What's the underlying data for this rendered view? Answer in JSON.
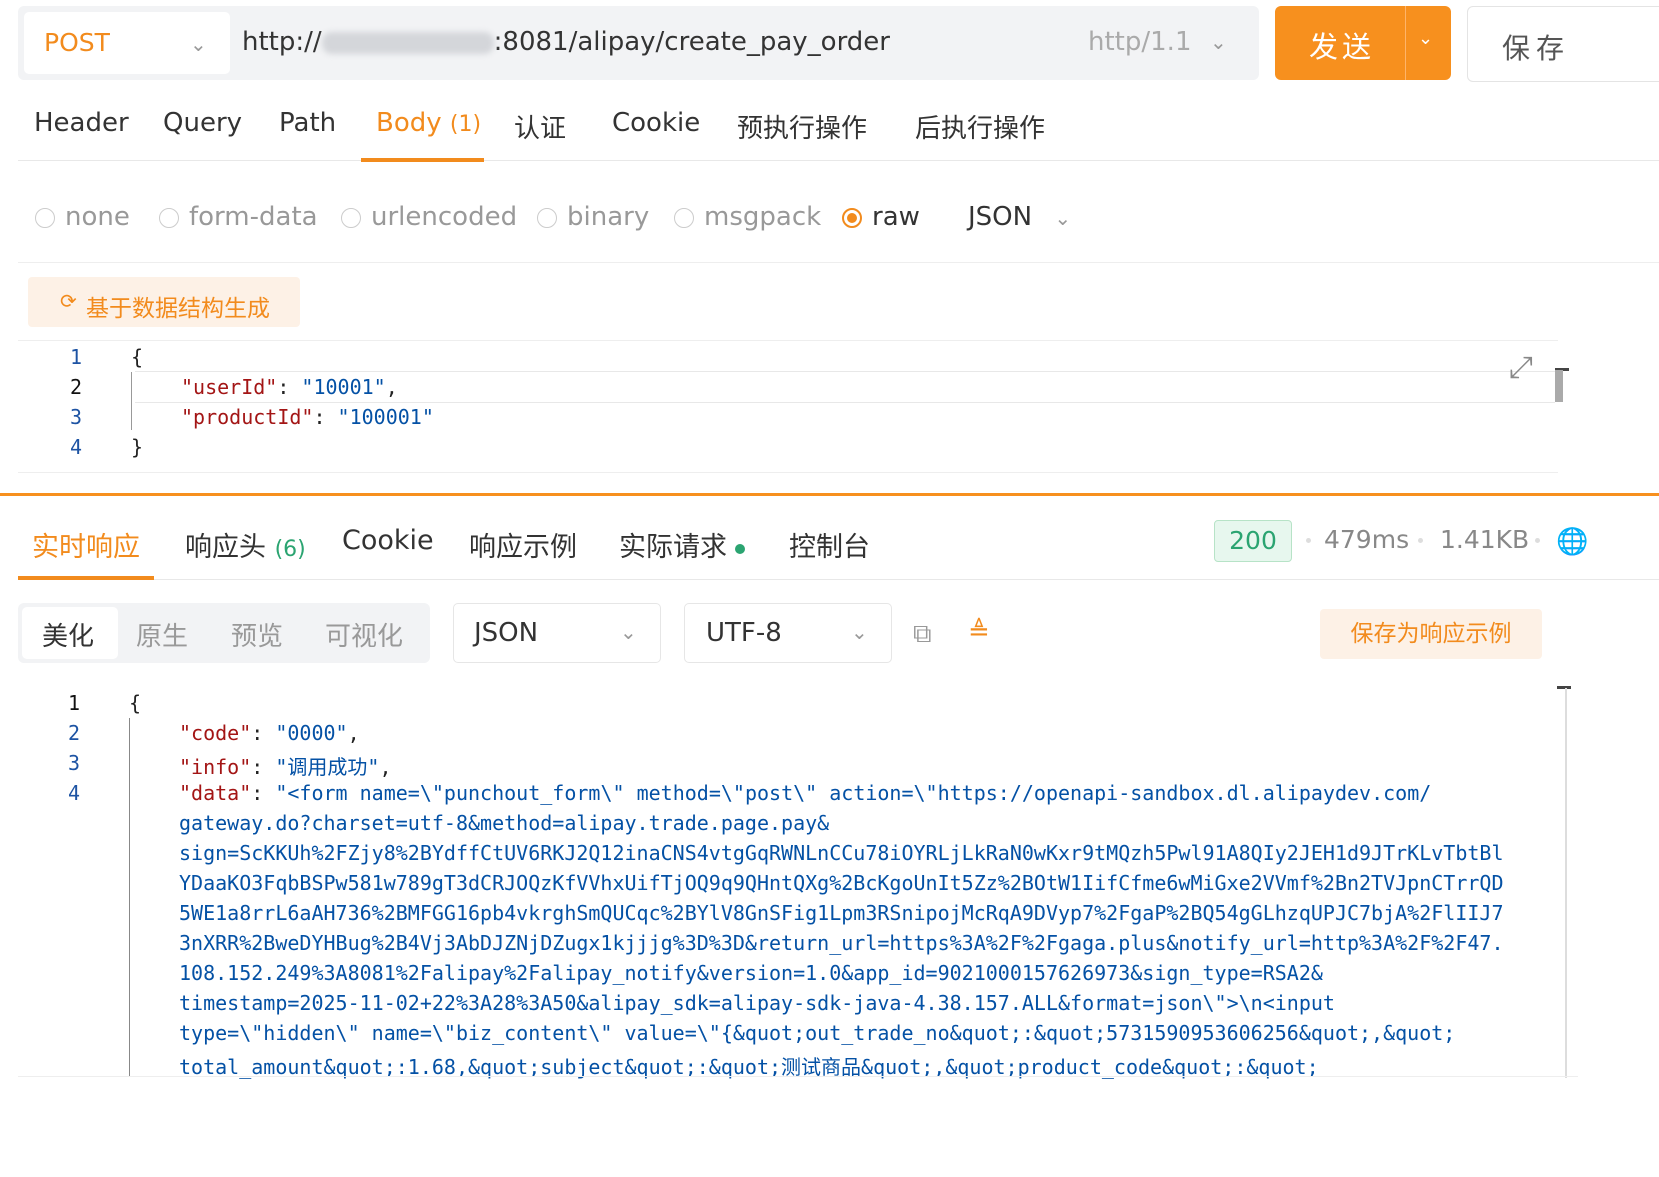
{
  "request": {
    "method": "POST",
    "url_prefix": "http://",
    "url_suffix": ":8081/alipay/create_pay_order",
    "protocol": "http/1.1",
    "send_label": "发送",
    "save_label": "保存"
  },
  "request_tabs": [
    {
      "label": "Header"
    },
    {
      "label": "Query"
    },
    {
      "label": "Path"
    },
    {
      "label": "Body",
      "count": "(1)"
    },
    {
      "label": "认证"
    },
    {
      "label": "Cookie"
    },
    {
      "label": "预执行操作"
    },
    {
      "label": "后执行操作"
    }
  ],
  "body_types": [
    "none",
    "form-data",
    "urlencoded",
    "binary",
    "msgpack",
    "raw"
  ],
  "body_format": "JSON",
  "generate_button": "基于数据结构生成",
  "request_body": {
    "line_numbers": [
      "1",
      "2",
      "3",
      "4"
    ],
    "lines": [
      "{",
      "\"userId\": \"10001\",",
      "\"productId\": \"100001\"",
      "}"
    ]
  },
  "response_tabs": [
    {
      "label": "实时响应"
    },
    {
      "label": "响应头",
      "count": "(6)"
    },
    {
      "label": "Cookie"
    },
    {
      "label": "响应示例"
    },
    {
      "label": "实际请求"
    },
    {
      "label": "控制台"
    }
  ],
  "response_meta": {
    "status": "200",
    "time": "479ms",
    "size": "1.41KB"
  },
  "view_modes": [
    "美化",
    "原生",
    "预览",
    "可视化"
  ],
  "response_format": "JSON",
  "encoding": "UTF-8",
  "save_example_label": "保存为响应示例",
  "response_body": {
    "line_numbers": [
      "1",
      "2",
      "3",
      "4"
    ],
    "open_brace": "{",
    "code_key": "\"code\"",
    "code_val": "\"0000\"",
    "info_key": "\"info\"",
    "info_val": "\"调用成功\"",
    "data_key": "\"data\"",
    "data_lines": [
      "\"<form name=\\\"punchout_form\\\" method=\\\"post\\\" action=\\\"https://openapi-sandbox.dl.alipaydev.com/",
      "gateway.do?charset=utf-8&method=alipay.trade.page.pay&",
      "sign=ScKKUh%2FZjy8%2BYdffCtUV6RKJ2Q12inaCNS4vtgGqRWNLnCCu78iOYRLjLkRaN0wKxr9tMQzh5Pwl91A8QIy2JEH1d9JTrKLvTbtBl",
      "YDaaKO3FqbBSPw581w789gT3dCRJOQzKfVVhxUifTjOQ9q9QHntQXg%2BcKgoUnIt5Zz%2BOtW1IifCfme6wMiGxe2VVmf%2Bn2TVJpnCTrrQD",
      "5WE1a8rrL6aAH736%2BMFGG16pb4vkrghSmQUCqc%2BYlV8GnSFig1Lpm3RSnipojMcRqA9DVyp7%2FgaP%2BQ54gGLhzqUPJC7bjA%2FlIIJ7",
      "3nXRR%2BweDYHBug%2B4Vj3AbDJZNjDZugx1kjjjg%3D%3D&return_url=https%3A%2F%2Fgaga.plus&notify_url=http%3A%2F%2F47.",
      "108.152.249%3A8081%2Falipay%2Falipay_notify&version=1.0&app_id=9021000157626973&sign_type=RSA2&",
      "timestamp=2025-11-02+22%3A28%3A50&alipay_sdk=alipay-sdk-java-4.38.157.ALL&format=json\\\">\\n<input",
      "type=\\\"hidden\\\" name=\\\"biz_content\\\" value=\\\"{&quot;out_trade_no&quot;:&quot;5731590953606256&quot;,&quot;",
      "total_amount&quot;:1.68,&quot;subject&quot;:&quot;测试商品&quot;,&quot;product_code&quot;:&quot;"
    ]
  },
  "colors": {
    "accent": "#f7901e",
    "status_ok": "#2ba471",
    "json_key": "#a31515",
    "json_string": "#0451a5"
  }
}
